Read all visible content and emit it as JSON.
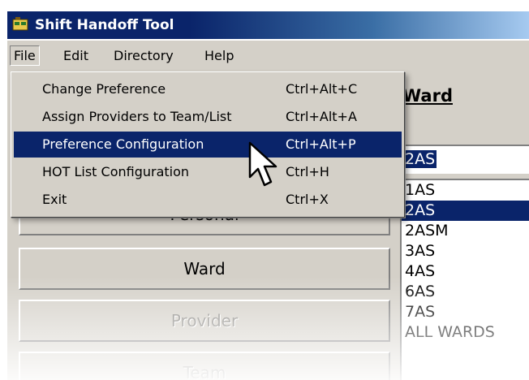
{
  "window": {
    "title": "Shift Handoff Tool",
    "app_icon": "app-icon"
  },
  "menubar": {
    "items": [
      {
        "label": "File",
        "state": "open"
      },
      {
        "label": "Edit"
      },
      {
        "label": "Directory"
      },
      {
        "label": "Help"
      }
    ]
  },
  "file_menu": {
    "items": [
      {
        "label": "Change Preference",
        "shortcut": "Ctrl+Alt+C"
      },
      {
        "label": "Assign Providers to Team/List",
        "shortcut": "Ctrl+Alt+A"
      },
      {
        "label": "Preference Configuration",
        "shortcut": "Ctrl+Alt+P",
        "highlighted": true
      },
      {
        "label": "HOT List Configuration",
        "shortcut": "Ctrl+H"
      },
      {
        "label": "Exit",
        "shortcut": "Ctrl+X"
      }
    ]
  },
  "nav_buttons": [
    {
      "label": "Personal",
      "enabled": true
    },
    {
      "label": "Ward",
      "enabled": true
    },
    {
      "label": "Provider",
      "enabled": false
    },
    {
      "label": "Team",
      "enabled": false
    }
  ],
  "ward_panel": {
    "label": "Ward",
    "selected_value": "2AS",
    "options": [
      "1AS",
      "2AS",
      "2ASM",
      "3AS",
      "4AS",
      "6AS",
      "7AS",
      "ALL WARDS"
    ],
    "selected_option": "2AS"
  },
  "colors": {
    "highlight": "#0a246a",
    "face": "#d4d0c8"
  }
}
